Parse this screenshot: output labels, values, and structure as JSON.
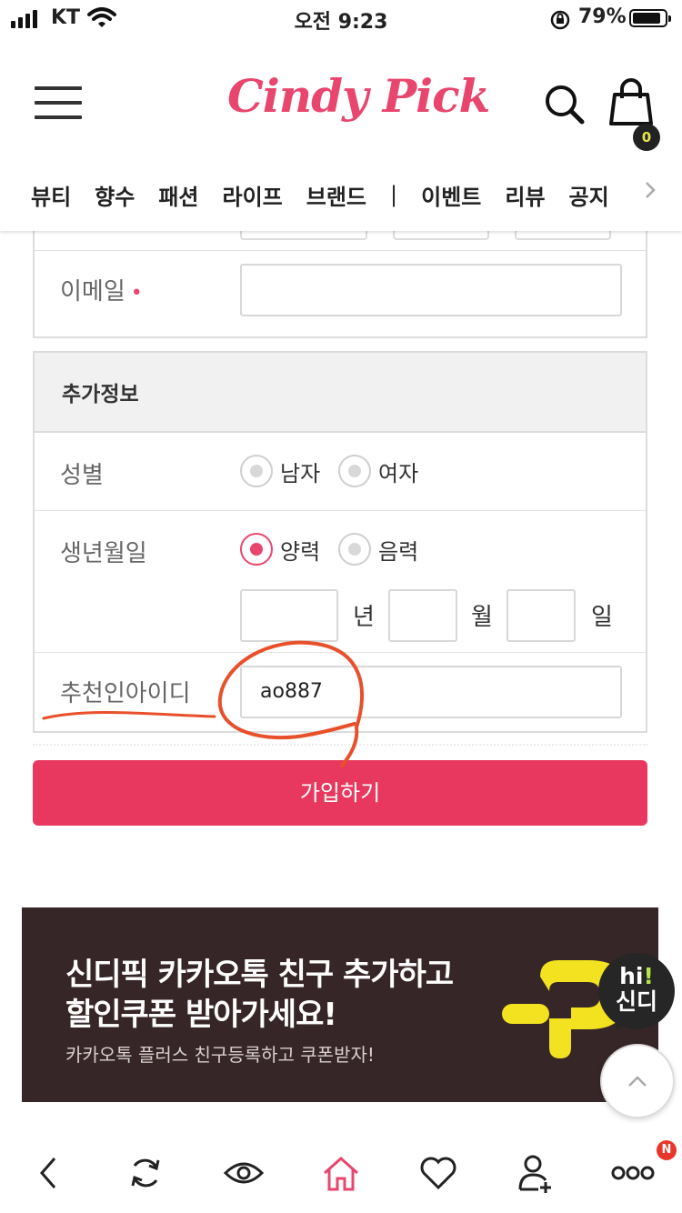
{
  "status_bar": {
    "carrier": "KT",
    "time": "오전 9:23",
    "battery_percent": "79%",
    "battery_level": 0.79
  },
  "header": {
    "logo": "Cindy Pick",
    "cart_count": "0",
    "categories": [
      "뷰티",
      "향수",
      "패션",
      "라이프",
      "브랜드",
      "|",
      "이벤트",
      "리뷰",
      "공지"
    ]
  },
  "form": {
    "email_label": "이메일",
    "email_required_mark": "•",
    "email_value": "",
    "extra_section_title": "추가정보",
    "gender_label": "성별",
    "gender_options": [
      "남자",
      "여자"
    ],
    "birthday_label": "생년월일",
    "calendar_options": [
      "양력",
      "음력"
    ],
    "calendar_selected": "양력",
    "year_unit": "년",
    "month_unit": "월",
    "day_unit": "일",
    "referrer_label": "추천인아이디",
    "referrer_value": "ao887",
    "submit_label": "가입하기"
  },
  "banner": {
    "line1": "신디픽 카카오톡 친구 추가하고",
    "line2": "할인쿠폰 받아가세요!",
    "subtitle": "카카오톡 플러스 친구등록하고 쿠폰받자!"
  },
  "chat_bubble": {
    "line1_prefix": "hi",
    "line1_mark": "!",
    "line2": "신디"
  },
  "bottom_bar": {
    "icons": [
      "back-icon",
      "refresh-icon",
      "eye-icon",
      "home-icon",
      "heart-icon",
      "add-user-icon",
      "more-icon"
    ],
    "notification_badge": "N"
  },
  "colors": {
    "brand": "#e8466d",
    "button": "#e8385f",
    "banner_bg": "#372627",
    "annotation": "#e8502c"
  }
}
